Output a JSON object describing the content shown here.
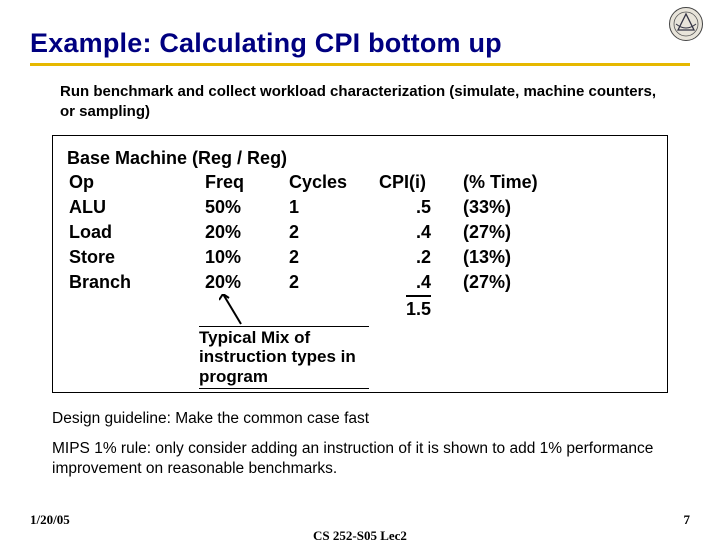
{
  "title": "Example: Calculating CPI bottom up",
  "subtitle": "Run benchmark and collect workload characterization (simulate, machine counters, or sampling)",
  "box_header": "Base Machine (Reg / Reg)",
  "columns": {
    "op": "Op",
    "freq": "Freq",
    "cycles": "Cycles",
    "cpi": "CPI(i)",
    "time": "(% Time)"
  },
  "rows": [
    {
      "op": "ALU",
      "freq": "50%",
      "cycles": "1",
      "cpi": ".5",
      "time": "(33%)"
    },
    {
      "op": "Load",
      "freq": "20%",
      "cycles": "2",
      "cpi": ".4",
      "time": "(27%)"
    },
    {
      "op": "Store",
      "freq": "10%",
      "cycles": "2",
      "cpi": ".2",
      "time": "(13%)"
    },
    {
      "op": "Branch",
      "freq": "20%",
      "cycles": "2",
      "cpi": ".4",
      "time": "(27%)"
    }
  ],
  "total_cpi": "1.5",
  "mix_note": "Typical Mix of instruction types in program",
  "guideline": "Design guideline: Make the common case fast",
  "mips_rule": "MIPS 1% rule: only consider adding an instruction of it is shown to add 1% performance improvement on reasonable benchmarks.",
  "footer": {
    "date": "1/20/05",
    "course": "CS 252-S05 Lec2",
    "page": "7"
  }
}
